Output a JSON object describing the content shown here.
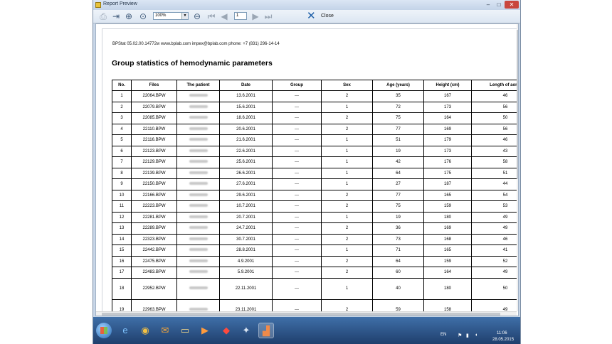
{
  "window": {
    "title": "Report Preview",
    "controls": {
      "minimize": "–",
      "maximize": "□",
      "close": "✕"
    }
  },
  "toolbar": {
    "zoom_value": "100%",
    "page_value": "1",
    "close_label": "Close",
    "icons": [
      "print-icon",
      "export-icon",
      "zoom-in-icon",
      "zoom-fit-icon",
      "zoom-out-icon",
      "first-page-icon",
      "prev-page-icon",
      "next-page-icon",
      "last-page-icon",
      "close-x-icon"
    ]
  },
  "report": {
    "version_line": "BPStat 05.02.00.14772w  www.bplab.com impex@bplab.com phone: +7 (831) 296-14-14",
    "title": "Group statistics of hemodynamic parameters",
    "columns": [
      "No.",
      "Files",
      "The patient",
      "Date",
      "Group",
      "Sex",
      "Age (years)",
      "Height (cm)",
      "Length of aorta"
    ],
    "rows": [
      {
        "no": "1",
        "file": "22064.BPW",
        "date": "13.6.2001",
        "group": "---",
        "sex": "2",
        "age": "35",
        "height": "167",
        "aorta": "46"
      },
      {
        "no": "2",
        "file": "22079.BPW",
        "date": "15.6.2001",
        "group": "---",
        "sex": "1",
        "age": "72",
        "height": "173",
        "aorta": "56"
      },
      {
        "no": "3",
        "file": "22085.BPW",
        "date": "18.6.2001",
        "group": "---",
        "sex": "2",
        "age": "75",
        "height": "164",
        "aorta": "50"
      },
      {
        "no": "4",
        "file": "22110.BPW",
        "date": "20.6.2001",
        "group": "---",
        "sex": "2",
        "age": "77",
        "height": "169",
        "aorta": "56"
      },
      {
        "no": "5",
        "file": "22116.BPW",
        "date": "21.6.2001",
        "group": "---",
        "sex": "1",
        "age": "51",
        "height": "179",
        "aorta": "46"
      },
      {
        "no": "6",
        "file": "22123.BPW",
        "date": "22.6.2001",
        "group": "---",
        "sex": "1",
        "age": "19",
        "height": "173",
        "aorta": "43"
      },
      {
        "no": "7",
        "file": "22129.BPW",
        "date": "25.6.2001",
        "group": "---",
        "sex": "1",
        "age": "42",
        "height": "176",
        "aorta": "58"
      },
      {
        "no": "8",
        "file": "22139.BPW",
        "date": "26.6.2001",
        "group": "---",
        "sex": "1",
        "age": "64",
        "height": "175",
        "aorta": "51"
      },
      {
        "no": "9",
        "file": "22150.BPW",
        "date": "27.6.2001",
        "group": "---",
        "sex": "1",
        "age": "27",
        "height": "187",
        "aorta": "44"
      },
      {
        "no": "10",
        "file": "22166.BPW",
        "date": "29.6.2001",
        "group": "---",
        "sex": "2",
        "age": "77",
        "height": "165",
        "aorta": "54"
      },
      {
        "no": "11",
        "file": "22223.BPW",
        "date": "10.7.2001",
        "group": "---",
        "sex": "2",
        "age": "75",
        "height": "159",
        "aorta": "53"
      },
      {
        "no": "12",
        "file": "22281.BPW",
        "date": "20.7.2001",
        "group": "---",
        "sex": "1",
        "age": "19",
        "height": "180",
        "aorta": "49"
      },
      {
        "no": "13",
        "file": "22289.BPW",
        "date": "24.7.2001",
        "group": "---",
        "sex": "2",
        "age": "36",
        "height": "169",
        "aorta": "49"
      },
      {
        "no": "14",
        "file": "22323.BPW",
        "date": "30.7.2001",
        "group": "---",
        "sex": "2",
        "age": "73",
        "height": "168",
        "aorta": "46"
      },
      {
        "no": "15",
        "file": "22442.BPW",
        "date": "28.8.2001",
        "group": "---",
        "sex": "1",
        "age": "71",
        "height": "165",
        "aorta": "41"
      },
      {
        "no": "16",
        "file": "22475.BPW",
        "date": "4.9.2001",
        "group": "---",
        "sex": "2",
        "age": "64",
        "height": "159",
        "aorta": "52"
      },
      {
        "no": "17",
        "file": "22483.BPW",
        "date": "5.9.2001",
        "group": "---",
        "sex": "2",
        "age": "60",
        "height": "164",
        "aorta": "49"
      },
      {
        "no": "18",
        "file": "22952.BPW",
        "date": "22.11.2001",
        "group": "---",
        "sex": "1",
        "age": "40",
        "height": "180",
        "aorta": "50"
      },
      {
        "no": "19",
        "file": "22963.BPW",
        "date": "23.11.2001",
        "group": "---",
        "sex": "2",
        "age": "59",
        "height": "158",
        "aorta": "49"
      }
    ]
  },
  "taskbar": {
    "apps": [
      "ie-icon",
      "chrome-icon",
      "outlook-icon",
      "explorer-icon",
      "media-player-icon",
      "pdf-icon",
      "tool-icon",
      "bpstat-icon"
    ],
    "language": "EN",
    "time": "11:06",
    "date": "28.05.2015"
  }
}
